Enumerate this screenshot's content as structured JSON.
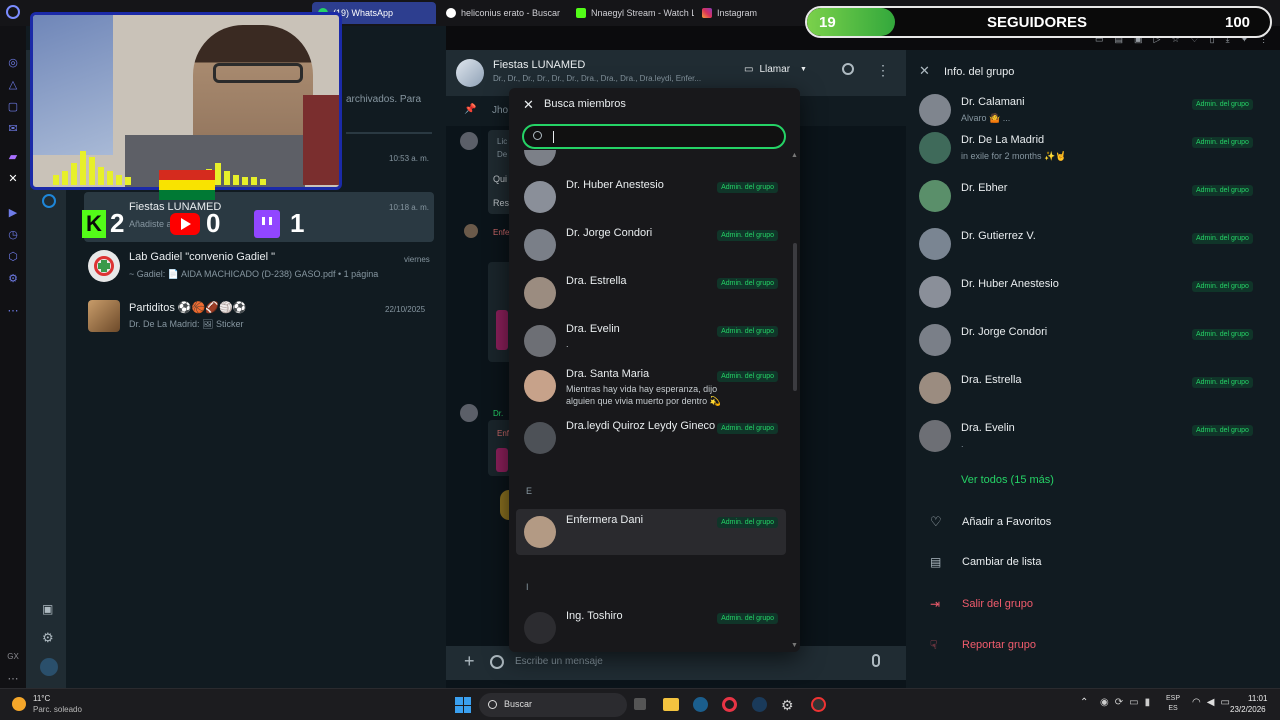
{
  "browser": {
    "tabs": [
      {
        "label": "(19) WhatsApp",
        "active": true
      },
      {
        "label": "heliconius erato - Buscar",
        "active": false
      },
      {
        "label": "Nnaegyl Stream - Watch L",
        "active": false
      },
      {
        "label": "Instagram",
        "active": false
      }
    ]
  },
  "overlay": {
    "followers_current": "19",
    "followers_label": "SEGUIDORES",
    "followers_goal": "100",
    "progress_fraction": 0.19,
    "kick_count": "2",
    "youtube_count": "0",
    "twitch_count": "1",
    "kick_letter": "K"
  },
  "chatlist": {
    "archived_text": "archivados. Para",
    "rows": [
      {
        "name": "",
        "msg": "",
        "time": "10:53 a. m."
      },
      {
        "name": "Fiestas LUNAMED",
        "msg": "Añadiste a...",
        "time": "10:18 a. m."
      },
      {
        "name": "Lab Gadiel \"convenio Gadiel \"",
        "msg": "~ Gadiel: 📄 AIDA MACHICADO (D-238) GASO.pdf • 1 página",
        "time": "viernes"
      },
      {
        "name": "Partiditos ⚽🏀🏈🏐⚽",
        "msg": "Dr. De La Madrid: 🖼 Sticker",
        "time": "22/10/2025"
      }
    ]
  },
  "chat": {
    "title": "Fiestas LUNAMED",
    "subtitle": "Dr., Dr., Dr., Dr., Dr., Dr., Dra., Dra., Dra., Dra.leydi, Enfer...",
    "call_label": "Llamar",
    "compose_placeholder": "Escribe un mensaje",
    "pinned_snippet": "Jho",
    "bg_snippets": [
      "Lic",
      "De s",
      "Qui",
      "Res",
      "Enfe",
      "Dr.",
      "Enf"
    ]
  },
  "dialog": {
    "title": "Busca miembros",
    "search_value": "",
    "section_e": "E",
    "section_i": "I",
    "members": [
      {
        "name": "Dr. Huber Anestesio",
        "sub": "",
        "badge": "Admin. del grupo"
      },
      {
        "name": "Dr. Jorge Condori",
        "sub": "",
        "badge": "Admin. del grupo"
      },
      {
        "name": "Dra. Estrella",
        "sub": "",
        "badge": "Admin. del grupo"
      },
      {
        "name": "Dra. Evelin",
        "sub": ".",
        "badge": "Admin. del grupo"
      },
      {
        "name": "Dra. Santa Maria",
        "sub": "Mientras hay vida hay esperanza, dijo alguien que vivia muerto por dentro 💫",
        "badge": "Admin. del grupo"
      },
      {
        "name": "Dra.leydi Quiroz Leydy Gineco",
        "sub": "",
        "badge": "Admin. del grupo"
      },
      {
        "name": "Enfermera Dani",
        "sub": "",
        "badge": "Admin. del grupo"
      },
      {
        "name": "Ing. Toshiro",
        "sub": "",
        "badge": "Admin. del grupo"
      }
    ]
  },
  "info": {
    "title": "Info. del grupo",
    "members": [
      {
        "name": "Dr. Calamani",
        "sub": "Alvaro 🤷 ...",
        "badge": "Admin. del grupo"
      },
      {
        "name": "Dr. De La Madrid",
        "sub": "in exile for 2 months ✨🤘",
        "badge": "Admin. del grupo"
      },
      {
        "name": "Dr. Ebher",
        "sub": "",
        "badge": "Admin. del grupo"
      },
      {
        "name": "Dr. Gutierrez V.",
        "sub": "",
        "badge": "Admin. del grupo"
      },
      {
        "name": "Dr. Huber Anestesio",
        "sub": "",
        "badge": "Admin. del grupo"
      },
      {
        "name": "Dr. Jorge Condori",
        "sub": "",
        "badge": "Admin. del grupo"
      },
      {
        "name": "Dra. Estrella",
        "sub": "",
        "badge": "Admin. del grupo"
      },
      {
        "name": "Dra. Evelin",
        "sub": ".",
        "badge": "Admin. del grupo"
      }
    ],
    "view_all": "Ver todos (15 más)",
    "actions": [
      {
        "label": "Añadir a Favoritos",
        "color": "#e9edef"
      },
      {
        "label": "Cambiar de lista",
        "color": "#e9edef"
      },
      {
        "label": "Salir del grupo",
        "color": "#f15c6d"
      },
      {
        "label": "Reportar grupo",
        "color": "#f15c6d"
      }
    ]
  },
  "taskbar": {
    "weather_temp": "11°C",
    "weather_desc": "Parc. soleado",
    "search_label": "Buscar",
    "lang_top": "ESP",
    "lang_bottom": "ES",
    "time": "11:01",
    "date": "23/2/2026"
  },
  "colors": {
    "accent": "#25d366",
    "danger": "#f15c6d",
    "panel": "#111b21"
  }
}
